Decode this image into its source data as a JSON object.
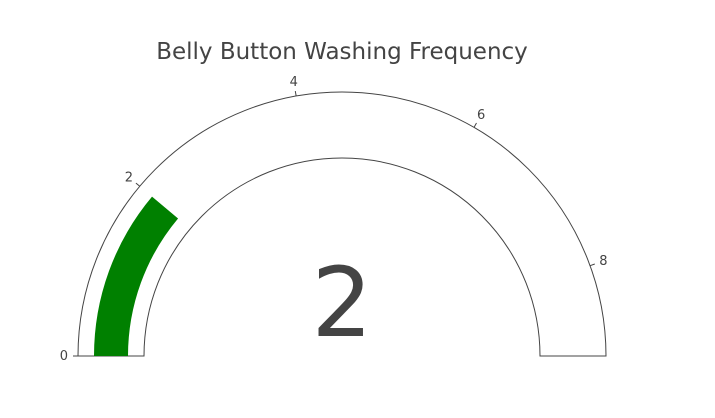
{
  "chart_data": {
    "type": "gauge",
    "title": "Belly Button Washing Frequency",
    "value": 2,
    "value_label": "2",
    "range": [
      0,
      9
    ],
    "ticks": [
      {
        "value": 0,
        "label": "0"
      },
      {
        "value": 2,
        "label": "2"
      },
      {
        "value": 4,
        "label": "4"
      },
      {
        "value": 6,
        "label": "6"
      },
      {
        "value": 8,
        "label": "8"
      }
    ],
    "bar_color": "#008000",
    "outline_color": "#444444",
    "background_color": "#ffffff"
  }
}
